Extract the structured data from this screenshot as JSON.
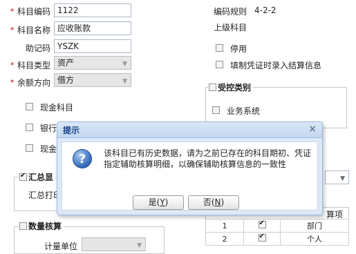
{
  "form": {
    "required_mark": "*",
    "code": {
      "label": "科目编码",
      "value": "1122"
    },
    "name": {
      "label": "科目名称",
      "value": "应收账款"
    },
    "mnemonic": {
      "label": "助记码",
      "value": "YSZK"
    },
    "type": {
      "label": "科目类型",
      "value": "资产"
    },
    "direction": {
      "label": "余额方向",
      "value": "借方"
    },
    "code_rule_label": "编码规则",
    "code_rule_value": "4-2-2",
    "parent_label": "上级科目",
    "disabled_label": "停用",
    "voucher_settle_label": "填制凭证时录入结算信息",
    "cash_label": "现金科目",
    "bank_label": "银行",
    "cash_eq_label": "现金",
    "summary_label": "汇总显",
    "summary_print_label": "汇总打印",
    "control_legend": "受控类别",
    "business_system_label": "业务系统",
    "quantity_legend": "数量核算",
    "unit_label": "计量单位"
  },
  "aux_table": {
    "header": "算项",
    "rows": [
      {
        "num": "1",
        "checked": true,
        "name": "部门"
      },
      {
        "num": "2",
        "checked": true,
        "name": "个人"
      }
    ]
  },
  "dialog": {
    "title": "提示",
    "close": "×",
    "message": "该科目已有历史数据，请为之前已存在的科目期初、凭证指定辅助核算明细，以确保辅助核算信息的一致性",
    "yes_label": "是",
    "yes_key": "Y",
    "no_label": "否",
    "no_key": "N"
  },
  "colors": {
    "dialog_title": "#15428b",
    "dialog_border": "#99bbe8",
    "required": "#c00000"
  }
}
